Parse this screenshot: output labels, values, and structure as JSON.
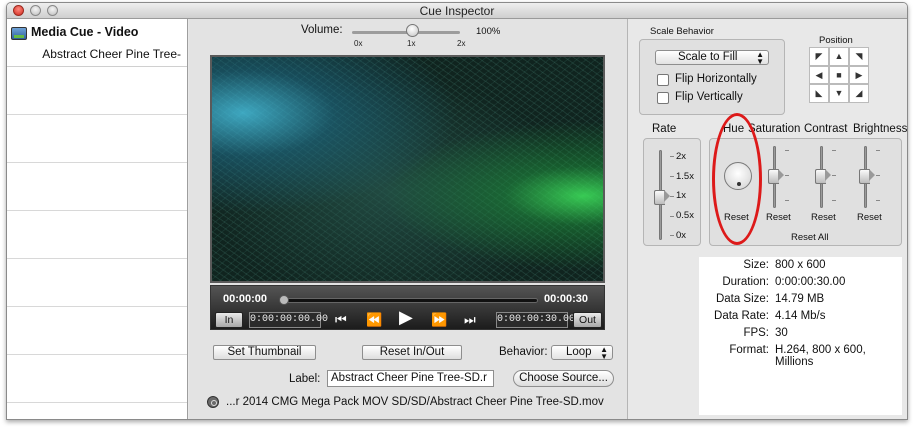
{
  "window": {
    "title": "Cue Inspector"
  },
  "cue": {
    "type": "Media Cue - Video",
    "name": "Abstract Cheer Pine Tree-"
  },
  "volume": {
    "label": "Volume:",
    "max_label": "100%",
    "ticks": [
      "0x",
      "1x",
      "2x"
    ],
    "value": 1
  },
  "transport": {
    "current_time": "00:00:00",
    "end_time": "00:00:30",
    "in_label": "In",
    "out_label": "Out",
    "in_time": "0:00:00:00.00",
    "out_time": "0:00:00:30.00",
    "progress": 0
  },
  "buttons": {
    "set_thumbnail": "Set Thumbnail",
    "reset_in_out": "Reset In/Out",
    "choose_source": "Choose Source..."
  },
  "behavior": {
    "label": "Behavior:",
    "value": "Loop"
  },
  "label_field": {
    "label": "Label:",
    "value": "Abstract Cheer Pine Tree-SD.r"
  },
  "path": "...r 2014 CMG Mega Pack MOV SD/SD/Abstract Cheer Pine Tree-SD.mov",
  "scale": {
    "title": "Scale Behavior",
    "value": "Scale to Fill",
    "flip_horizontal": "Flip Horizontally",
    "flip_vertical": "Flip Vertically"
  },
  "position": {
    "title": "Position"
  },
  "rate": {
    "title": "Rate",
    "ticks": [
      "2x",
      "1.5x",
      "1x",
      "0.5x",
      "0x"
    ]
  },
  "adjust": {
    "hue": "Hue",
    "saturation": "Saturation",
    "contrast": "Contrast",
    "brightness": "Brightness",
    "reset": "Reset",
    "reset_all": "Reset All"
  },
  "info": [
    {
      "key": "Size:",
      "value": "800 x 600"
    },
    {
      "key": "Duration:",
      "value": "0:00:00:30.00"
    },
    {
      "key": "Data Size:",
      "value": "14.79 MB"
    },
    {
      "key": "Data Rate:",
      "value": "4.14 Mb/s"
    },
    {
      "key": "FPS:",
      "value": "30"
    },
    {
      "key": "Format:",
      "value": "H.264, 800 x 600, Millions"
    }
  ],
  "colors": {
    "highlight_ring": "#dd1a1a"
  }
}
